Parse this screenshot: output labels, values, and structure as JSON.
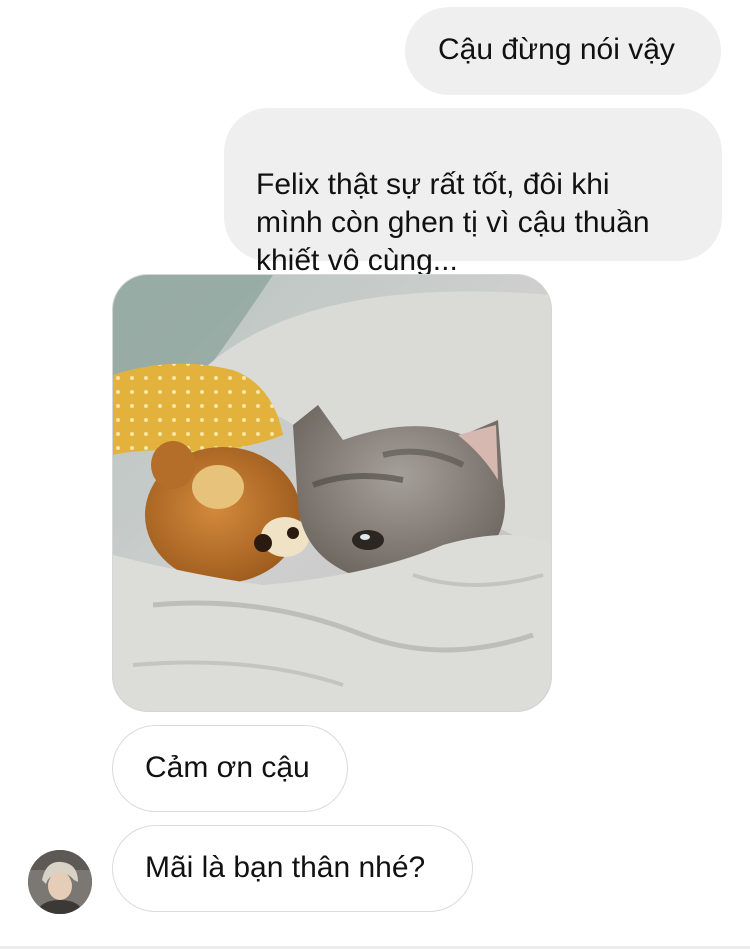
{
  "messages": [
    {
      "id": "m1",
      "direction": "sent",
      "text": "Cậu đừng nói vậy"
    },
    {
      "id": "m2",
      "direction": "sent",
      "text": "Felix thật sự rất tốt, đôi khi\nmình còn ghen tị vì cậu thuần\nkhiết vô cùng..."
    },
    {
      "id": "m3",
      "direction": "received",
      "type": "photo",
      "icon": "crying-cat-photo"
    },
    {
      "id": "m4",
      "direction": "received",
      "text": "Cảm ơn cậu"
    },
    {
      "id": "m5",
      "direction": "received",
      "text": "Mãi là bạn thân nhé?"
    }
  ],
  "colors": {
    "sent_bubble": "#efefef",
    "received_border": "#dbdbdb",
    "text": "#111111"
  },
  "avatar": {
    "icon": "user-avatar-photo"
  }
}
